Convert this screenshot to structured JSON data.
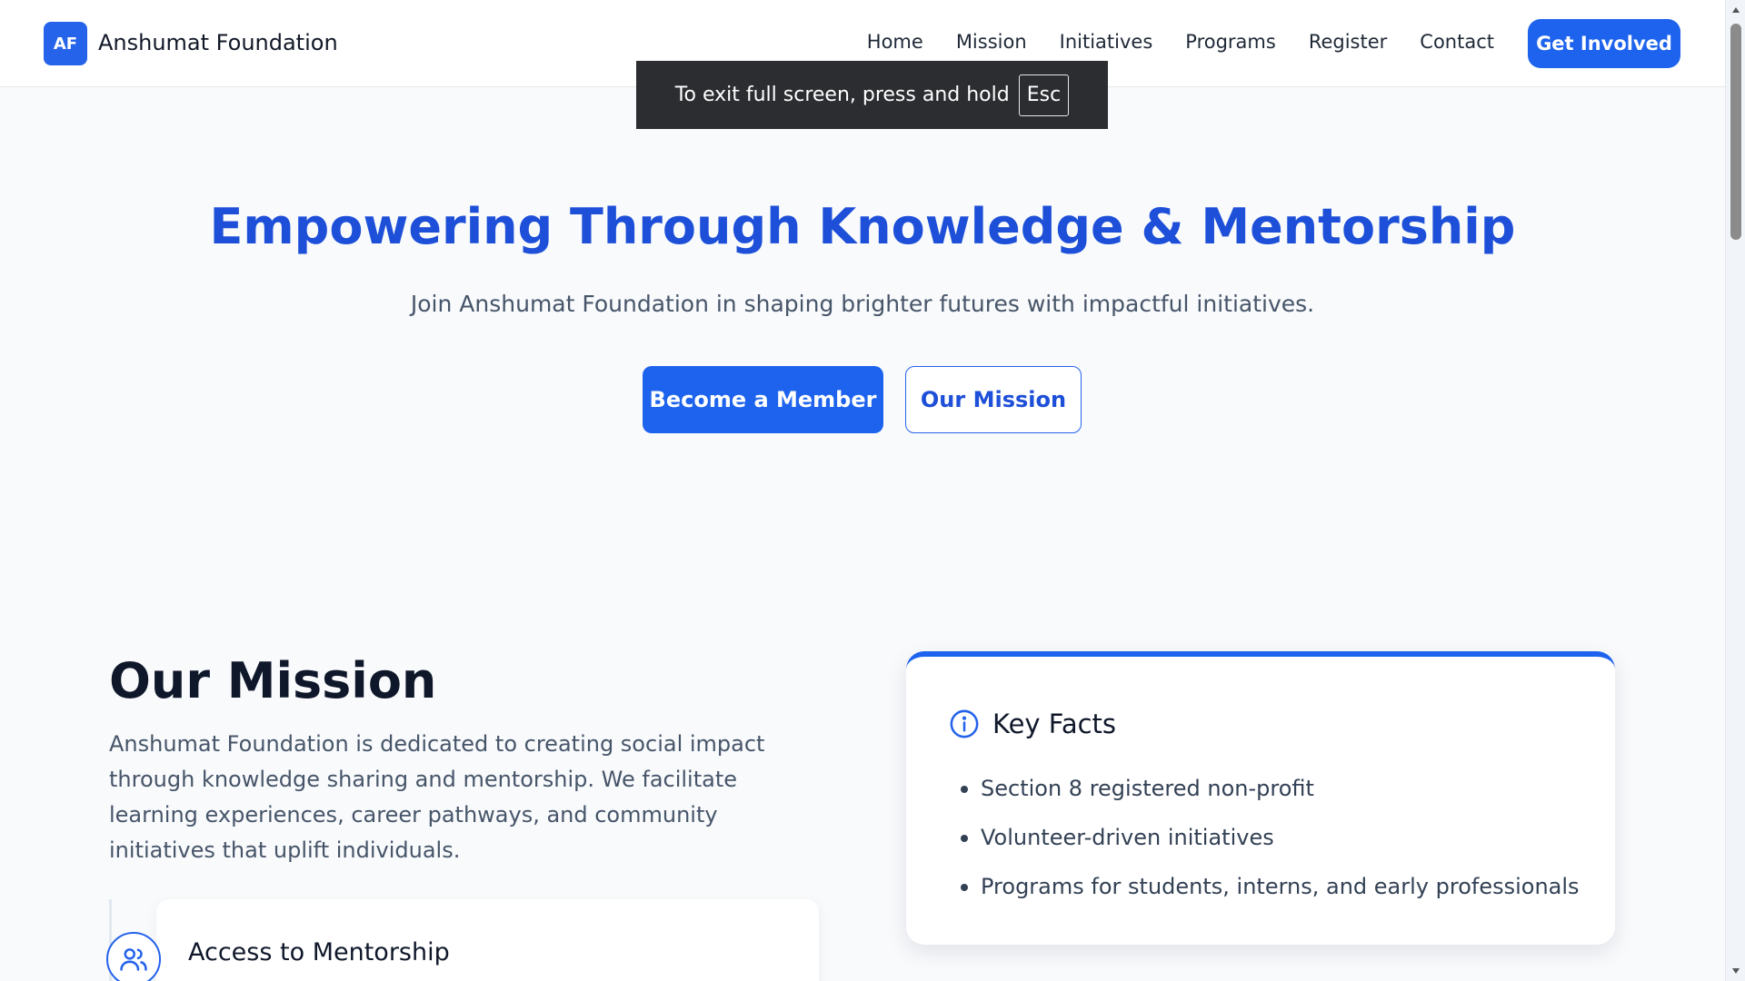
{
  "header": {
    "logo_initials": "AF",
    "brand": "Anshumat Foundation",
    "nav": [
      "Home",
      "Mission",
      "Initiatives",
      "Programs",
      "Register",
      "Contact"
    ],
    "cta": "Get Involved"
  },
  "fullscreen_toast": {
    "message": "To exit full screen, press and hold",
    "key": "Esc"
  },
  "hero": {
    "title": "Empowering Through Knowledge & Mentorship",
    "subtitle": "Join Anshumat Foundation in shaping brighter futures with impactful initiatives.",
    "primary_button": "Become a Member",
    "secondary_button": "Our Mission"
  },
  "mission": {
    "title": "Our Mission",
    "text": "Anshumat Foundation is dedicated to creating social impact through knowledge sharing and mentorship. We facilitate learning experiences, career pathways, and community initiatives that uplift individuals.",
    "card_title": "Access to Mentorship",
    "card_icon": "users-icon"
  },
  "key_facts": {
    "title": "Key Facts",
    "icon": "info-icon",
    "items": [
      "Section 8 registered non-profit",
      "Volunteer-driven initiatives",
      "Programs for students, interns, and early professionals"
    ]
  },
  "colors": {
    "primary": "#1d63ed",
    "heading_blue": "#1d4fd8",
    "background": "#f8fafc",
    "toast_bg": "#2b2d31"
  }
}
